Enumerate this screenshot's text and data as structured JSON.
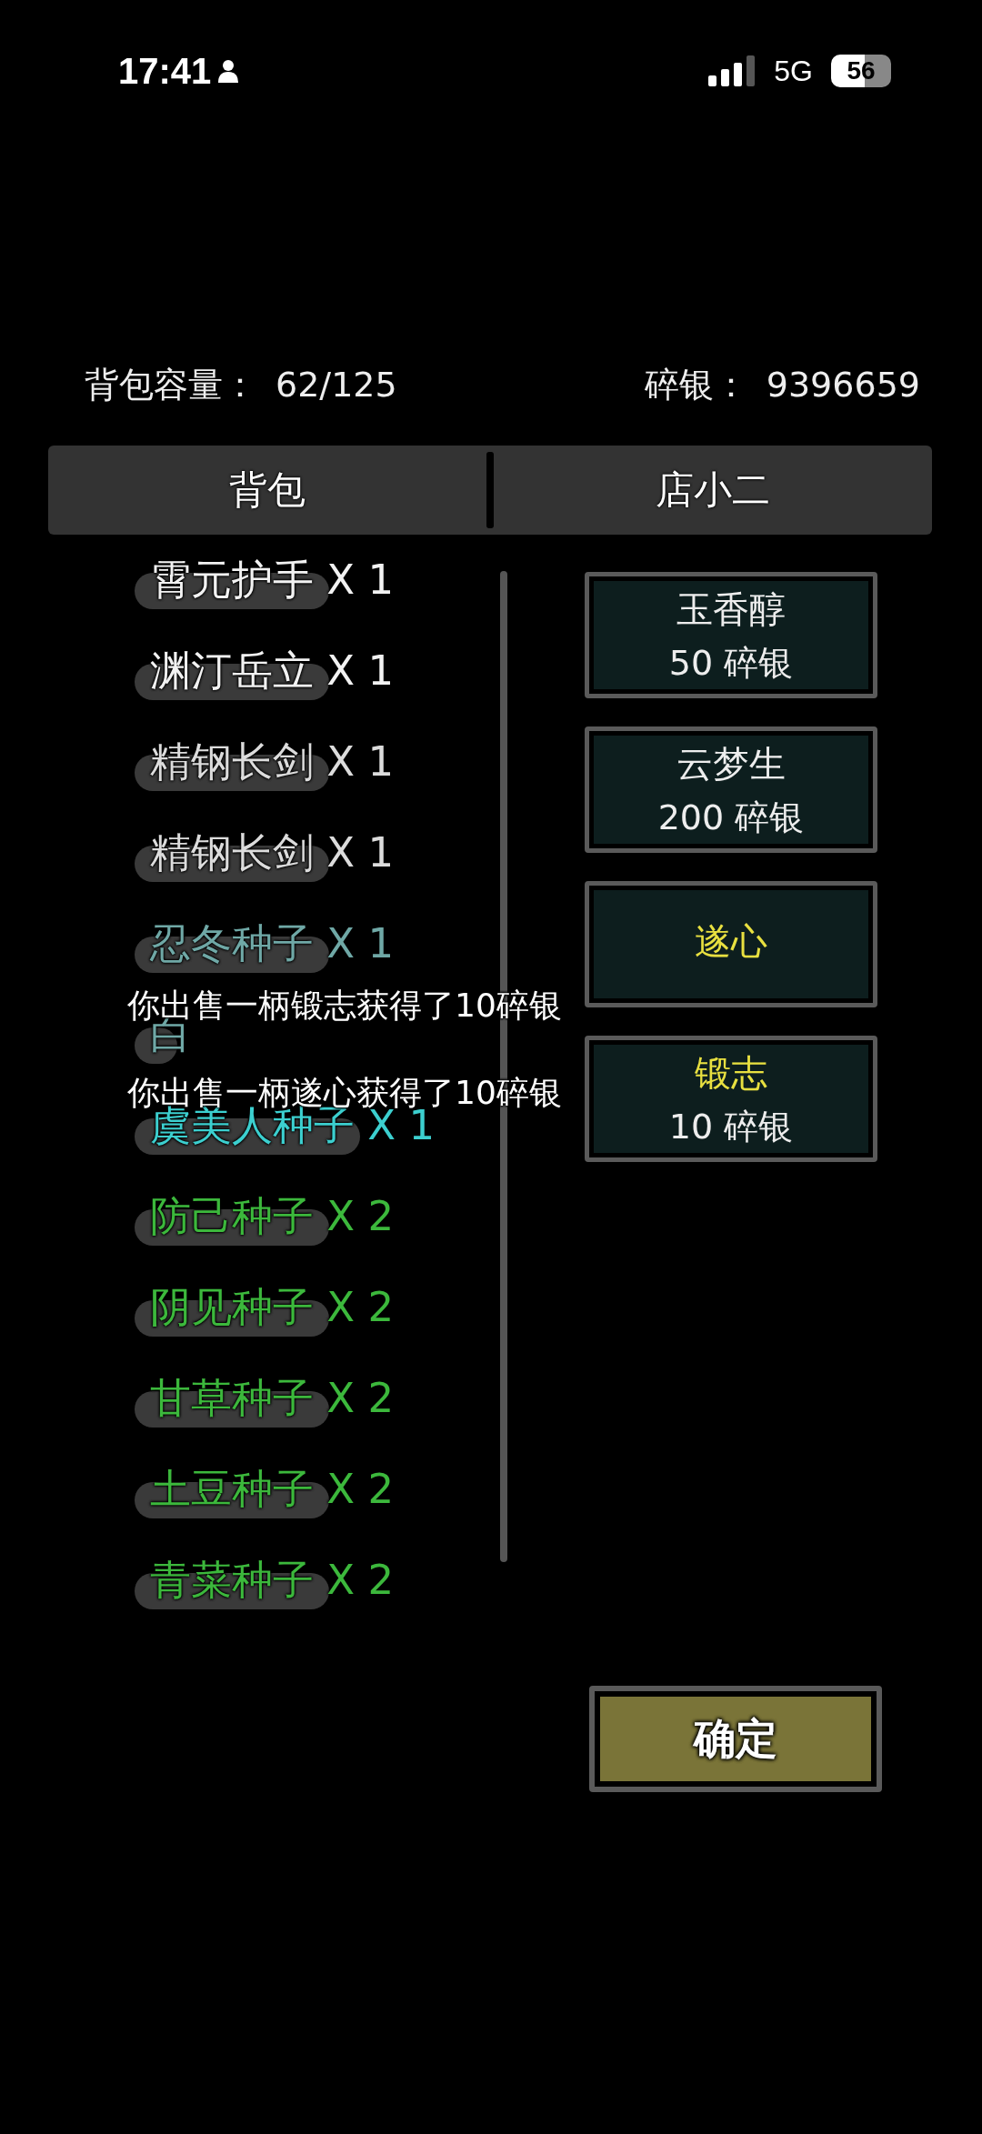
{
  "status_bar": {
    "time": "17:41",
    "network": "5G",
    "battery": "56"
  },
  "summary": {
    "capacity_label": "背包容量：",
    "capacity": "62/125",
    "silver_label": "碎银：",
    "silver": "9396659"
  },
  "tabs": [
    {
      "label": "背包",
      "selected": false
    },
    {
      "label": "店小二",
      "selected": false
    }
  ],
  "inventory": [
    {
      "name": "霄元护手 X 1",
      "color": "#f2f2f2"
    },
    {
      "name": "渊汀岳立 X 1",
      "color": "#f2f2f2"
    },
    {
      "name": "精钢长剑 X 1",
      "color": "#dcdcdc"
    },
    {
      "name": "精钢长剑 X 1",
      "color": "#dcdcdc"
    },
    {
      "name": "忍冬种子 X 1",
      "color": "#6fa8a6"
    },
    {
      "name": "白",
      "color": "#6fa8a6"
    },
    {
      "name": "虞美人种子 X 1",
      "color": "#3ccfcf"
    },
    {
      "name": "防己种子 X 2",
      "color": "#3cb83c"
    },
    {
      "name": "阴见种子 X 2",
      "color": "#3cb83c"
    },
    {
      "name": "甘草种子 X 2",
      "color": "#3cb83c"
    },
    {
      "name": "土豆种子 X 2",
      "color": "#3cb83c"
    },
    {
      "name": "青菜种子 X 2",
      "color": "#3cb83c"
    }
  ],
  "shop": [
    {
      "name": "玉香醇",
      "price": "50 碎银",
      "color": "#ededed"
    },
    {
      "name": "云梦生",
      "price": "200 碎银",
      "color": "#ededed"
    },
    {
      "name": "遂心",
      "color": "#e8e040"
    },
    {
      "name": "锻志",
      "price": "10 碎银",
      "color": "#e8e040"
    }
  ],
  "messages": [
    "你出售一柄锻志获得了10碎银",
    "你出售一柄遂心获得了10碎银"
  ],
  "confirm_button": "确定"
}
